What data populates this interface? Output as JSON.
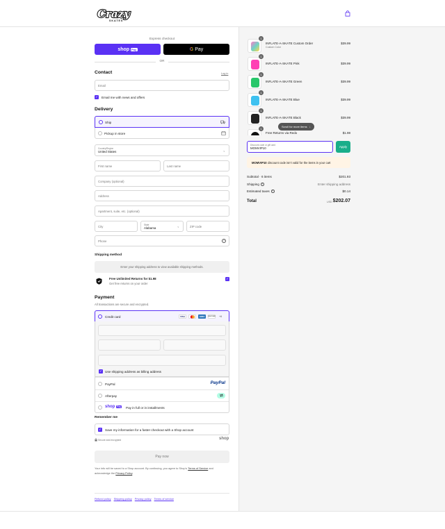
{
  "header": {
    "logo_text": "Crazy",
    "logo_sub": "SKATES",
    "cart_icon": "shopping-bag-icon"
  },
  "express": {
    "label": "Express checkout",
    "shop_pay": "shop",
    "shop_pay_badge": "Pay",
    "gpay": "Pay",
    "or": "OR"
  },
  "contact": {
    "title": "Contact",
    "login": "Log in",
    "email_placeholder": "Email",
    "news_label": "Email me with news and offers"
  },
  "delivery": {
    "title": "Delivery",
    "ship": "Ship",
    "pickup": "Pickup in store",
    "country_label": "Country/Region",
    "country": "United States",
    "first_name": "First name",
    "last_name": "Last name",
    "company": "Company (optional)",
    "address": "Address",
    "apartment": "Apartment, suite, etc. (optional)",
    "city": "City",
    "state_label": "State",
    "state": "Alabama",
    "zip": "ZIP code",
    "phone": "Phone"
  },
  "shipping": {
    "title": "Shipping method",
    "placeholder": "Enter your shipping address to view available shipping methods.",
    "returns_title": "Free Unlimited Returns for $1.98",
    "returns_sub": "Get free returns on your order"
  },
  "payment": {
    "title": "Payment",
    "subtitle": "All transactions are secure and encrypted.",
    "credit_card": "Credit card",
    "cards": [
      "VISA",
      "MC",
      "AMEX",
      "DISCOVER"
    ],
    "more_cards": "+6",
    "billing_same": "Use shipping address as billing address",
    "paypal": "PayPal",
    "paypal_logo": "PayPal",
    "afterpay": "Afterpay",
    "shop_pay_text": "Pay in full or in installments",
    "shop_pay_logo": "shop",
    "shop_pay_badge": "Pay"
  },
  "remember": {
    "title": "Remember me",
    "save_label": "Save my information for a faster checkout with a Shop account",
    "secure": "Secure and encrypted",
    "shop_logo": "shop"
  },
  "pay_now": "Pay now",
  "legal": {
    "text_1": "Your info will be saved to a Shop account. By continuing, you agree to Shop’s",
    "terms": "Terms of Service",
    "text_2": "and acknowledge the",
    "privacy": "Privacy Policy",
    "period": "."
  },
  "footer_links": [
    "Refund policy",
    "Shipping policy",
    "Privacy policy",
    "Terms of service"
  ],
  "order": {
    "items": [
      {
        "name": "INFLATE-A-SKATE Custom Order",
        "variant": "Custom Color",
        "qty": "1",
        "price": "$39.99",
        "color": "#6fd3c8"
      },
      {
        "name": "INFLATE-A-SKATE Pink",
        "variant": "",
        "qty": "1",
        "price": "$39.99",
        "color": "#ff3fb4"
      },
      {
        "name": "INFLATE-A-SKATE Green",
        "variant": "",
        "qty": "1",
        "price": "$39.99",
        "color": "#27c76a"
      },
      {
        "name": "INFLATE-A-SKATE Blue",
        "variant": "",
        "qty": "1",
        "price": "$39.99",
        "color": "#3ec1f0"
      },
      {
        "name": "INFLATE-A-SKATE Black",
        "variant": "",
        "qty": "1",
        "price": "$39.99",
        "color": "#222222"
      },
      {
        "name": "Free Returns via Redo",
        "variant": "",
        "qty": "1",
        "price": "$1.98",
        "color": "#111111"
      }
    ],
    "scroll_hint": "Scroll for more items",
    "discount_label": "Discount code or gift card",
    "discount_value": "MOMVIP10",
    "apply": "Apply",
    "discount_error_code": "MOMVIP10",
    "discount_error_text": "discount code isn’t valid for the items in your cart",
    "subtotal_label": "Subtotal · 6 items",
    "subtotal": "$201.93",
    "shipping_label": "Shipping",
    "shipping_value": "Enter shipping address",
    "taxes_label": "Estimated taxes",
    "taxes": "$0.14",
    "total_label": "Total",
    "currency": "USD",
    "total": "$202.07"
  },
  "colors": {
    "accent": "#5a31f4",
    "apply": "#1aae8a",
    "error_bg": "#fff4e5"
  }
}
